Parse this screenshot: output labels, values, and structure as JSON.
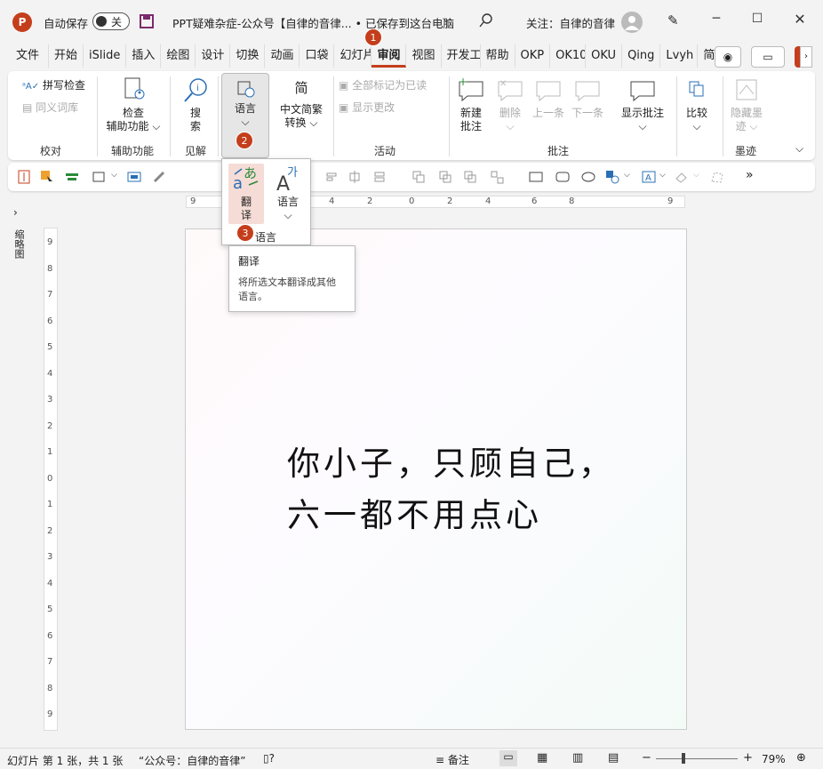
{
  "titlebar": {
    "app_icon": "P",
    "autosave_label": "自动保存",
    "autosave_state": "关",
    "doc_title": "PPT疑难杂症-公众号【自律的音律... • 已保存到这台电脑",
    "follow_text": "关注：自律的音律"
  },
  "tabs": [
    "文件",
    "开始",
    "iSlide",
    "插入",
    "绘图",
    "设计",
    "切换",
    "动画",
    "口袋",
    "幻灯片",
    "审阅",
    "视图",
    "开发工",
    "帮助",
    "OKP",
    "OK10",
    "OKU",
    "Qing",
    "Lvyh",
    "简报"
  ],
  "active_tab": "审阅",
  "badges": [
    "1",
    "2",
    "3"
  ],
  "ribbon": {
    "spell_check": "拼写检查",
    "thesaurus": "同义词库",
    "group_proofing": "校对",
    "check_access_1": "检查",
    "check_access_2": "辅助功能",
    "group_access": "辅助功能",
    "search_1": "搜",
    "search_2": "索",
    "group_insights": "见解",
    "language": "语言",
    "zh_convert_1": "中文简繁",
    "zh_convert_2": "转换",
    "mark_all_read": "全部标记为已读",
    "show_changes": "显示更改",
    "group_activity": "活动",
    "new_comment_1": "新建",
    "new_comment_2": "批注",
    "delete": "删除",
    "prev": "上一条",
    "next": "下一条",
    "show_comments": "显示批注",
    "group_comments": "批注",
    "compare": "比较",
    "hide_ink_1": "隐藏墨",
    "hide_ink_2": "迹",
    "group_ink": "墨迹"
  },
  "dropdown": {
    "translate_1": "翻",
    "translate_2": "译",
    "language": "语言",
    "group_label": "语言"
  },
  "tooltip": {
    "title": "翻译",
    "desc_1": "将所选文本翻译成其他",
    "desc_2": "语言。"
  },
  "slide": {
    "line1": "你小子，只顾自己，",
    "line2": "六一都不用点心"
  },
  "left_pane_label": "缩略图",
  "ruler_h": [
    "9",
    "4",
    "2",
    "0",
    "2",
    "4",
    "6",
    "8",
    "9"
  ],
  "ruler_v": [
    "9",
    "8",
    "7",
    "6",
    "5",
    "4",
    "3",
    "2",
    "1",
    "0",
    "1",
    "2",
    "3",
    "4",
    "5",
    "6",
    "7",
    "8",
    "9"
  ],
  "status": {
    "slide_info": "幻灯片 第 1 张，共 1 张",
    "theme": "“公众号：自律的音律”",
    "notes": "备注",
    "zoom": "79%"
  },
  "colors": {
    "accent": "#c43e1c",
    "ribbon_bg": "#ffffff",
    "window_bg": "#f3f3f3"
  }
}
